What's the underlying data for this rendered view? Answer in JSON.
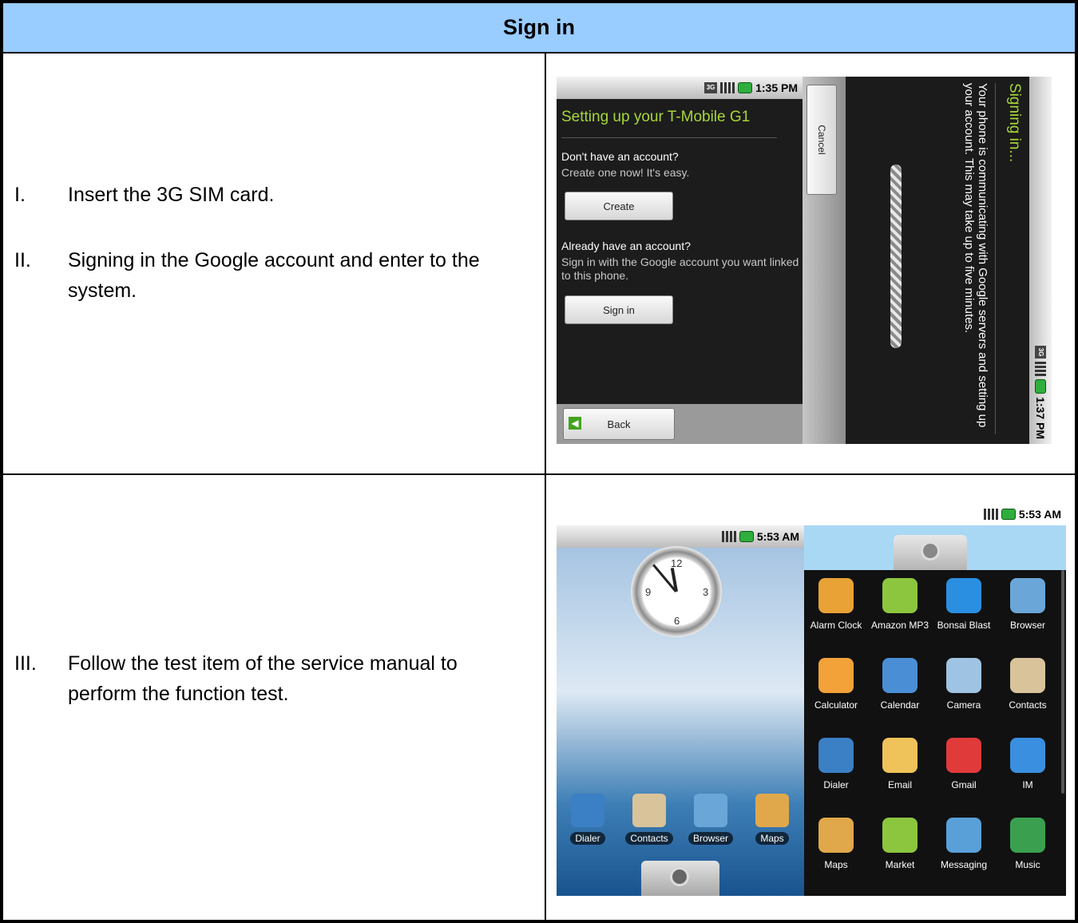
{
  "header": {
    "title": "Sign in"
  },
  "steps": [
    {
      "num": "I.",
      "text": "Insert the 3G SIM card."
    },
    {
      "num": "II.",
      "text": "Signing in the Google account and enter to the system."
    },
    {
      "num": "III.",
      "text": "Follow the test item of the service manual to perform the function test."
    }
  ],
  "screen1": {
    "time": "1:35 PM",
    "net": "3G",
    "title": "Setting up your T-Mobile G1",
    "q1": "Don't have an account?",
    "sub1": "Create one now! It's easy.",
    "create_label": "Create",
    "q2": "Already have an account?",
    "sub2": "Sign in with the Google account you want linked to this phone.",
    "signin_label": "Sign in",
    "back_label": "Back",
    "cancel_label": "Cancel"
  },
  "screen2": {
    "time": "1:37 PM",
    "title": "Signing in...",
    "message": "Your phone is communicating with Google servers and setting up your account. This may take up to five minutes."
  },
  "home": {
    "time": "5:53 AM",
    "dock": [
      {
        "label": "Dialer",
        "icon": "dialer-icon",
        "color": "#3b7fc4"
      },
      {
        "label": "Contacts",
        "icon": "contacts-icon",
        "color": "#d9c39a"
      },
      {
        "label": "Browser",
        "icon": "browser-icon",
        "color": "#6aa7d8"
      },
      {
        "label": "Maps",
        "icon": "maps-icon",
        "color": "#e0a84a"
      }
    ]
  },
  "drawer": {
    "time": "5:53 AM",
    "apps": [
      {
        "label": "Alarm Clock",
        "icon": "alarm-clock-icon",
        "color": "#e8a236"
      },
      {
        "label": "Amazon MP3",
        "icon": "amazon-mp3-icon",
        "color": "#8cc63f"
      },
      {
        "label": "Bonsai Blast",
        "icon": "bonsai-blast-icon",
        "color": "#2a8fe0"
      },
      {
        "label": "Browser",
        "icon": "browser-icon",
        "color": "#6aa7d8"
      },
      {
        "label": "Calculator",
        "icon": "calculator-icon",
        "color": "#f3a23a"
      },
      {
        "label": "Calendar",
        "icon": "calendar-icon",
        "color": "#4a8fd6"
      },
      {
        "label": "Camera",
        "icon": "camera-icon",
        "color": "#9fc3e2"
      },
      {
        "label": "Contacts",
        "icon": "contacts-icon",
        "color": "#d9c39a"
      },
      {
        "label": "Dialer",
        "icon": "dialer-icon",
        "color": "#3b7fc4"
      },
      {
        "label": "Email",
        "icon": "email-icon",
        "color": "#f0c35a"
      },
      {
        "label": "Gmail",
        "icon": "gmail-icon",
        "color": "#e03a3a"
      },
      {
        "label": "IM",
        "icon": "im-icon",
        "color": "#3a8fe0"
      },
      {
        "label": "Maps",
        "icon": "maps-icon",
        "color": "#e0a84a"
      },
      {
        "label": "Market",
        "icon": "market-icon",
        "color": "#8cc63f"
      },
      {
        "label": "Messaging",
        "icon": "messaging-icon",
        "color": "#5aa0d8"
      },
      {
        "label": "Music",
        "icon": "music-icon",
        "color": "#3aa050"
      }
    ]
  }
}
